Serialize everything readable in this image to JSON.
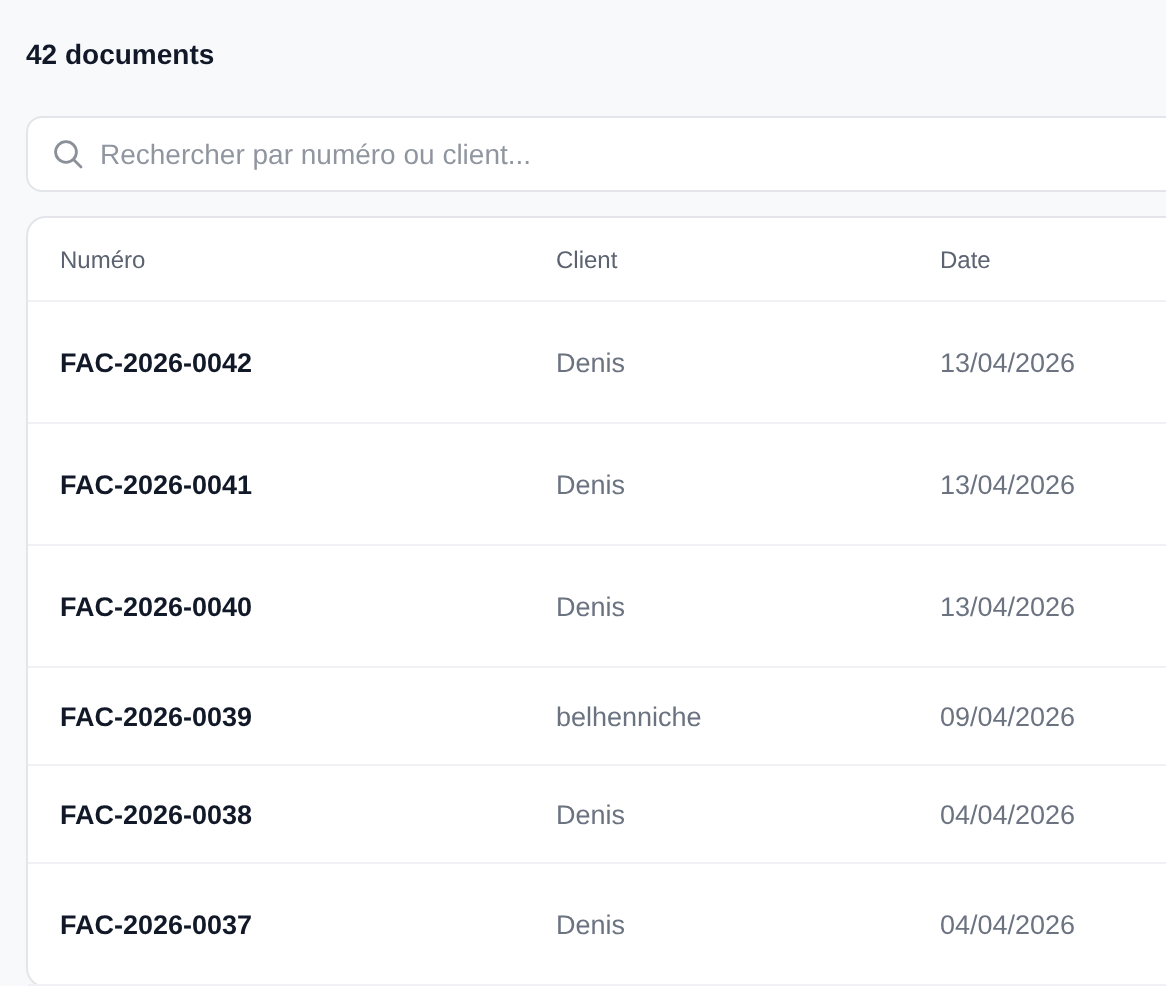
{
  "title": "42 documents",
  "search": {
    "placeholder": "Rechercher par numéro ou client..."
  },
  "table": {
    "columns": [
      "Numéro",
      "Client",
      "Date"
    ],
    "rows": [
      {
        "number": "FAC-2026-0042",
        "client": "Denis",
        "date": "13/04/2026"
      },
      {
        "number": "FAC-2026-0041",
        "client": "Denis",
        "date": "13/04/2026"
      },
      {
        "number": "FAC-2026-0040",
        "client": "Denis",
        "date": "13/04/2026"
      },
      {
        "number": "FAC-2026-0039",
        "client": "belhenniche",
        "date": "09/04/2026"
      },
      {
        "number": "FAC-2026-0038",
        "client": "Denis",
        "date": "04/04/2026"
      },
      {
        "number": "FAC-2026-0037",
        "client": "Denis",
        "date": "04/04/2026"
      }
    ]
  }
}
